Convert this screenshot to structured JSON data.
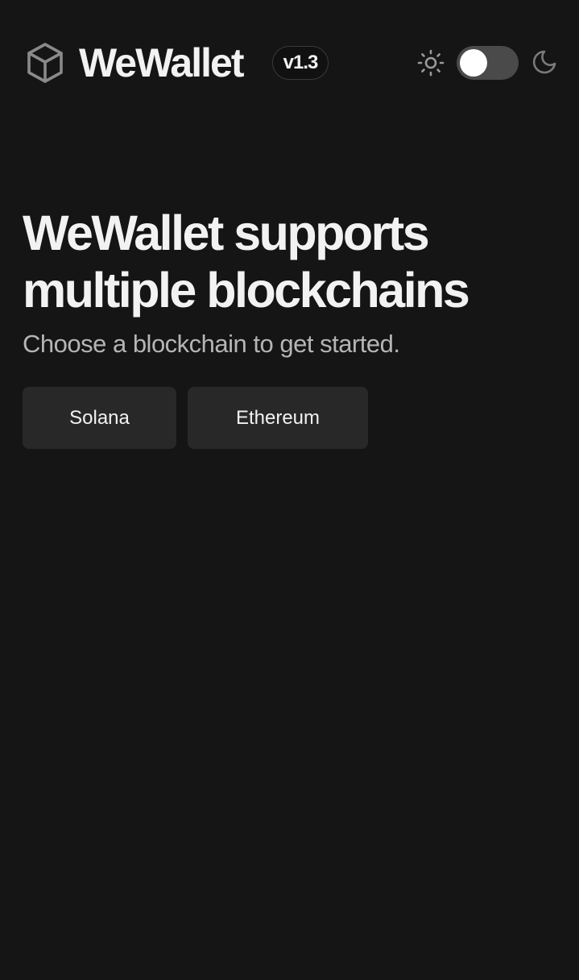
{
  "header": {
    "brand_name": "WeWallet",
    "version": "v1.3",
    "logo_icon": "cube-icon",
    "theme_toggle": {
      "light_icon": "sun-icon",
      "dark_icon": "moon-icon",
      "enabled": false
    }
  },
  "hero": {
    "title": "WeWallet supports multiple blockchains",
    "subtitle": "Choose a blockchain to get started."
  },
  "blockchains": [
    {
      "label": "Solana"
    },
    {
      "label": "Ethereum"
    }
  ],
  "colors": {
    "background": "#151515",
    "button_background": "#282828",
    "toggle_track": "#4a4a4a",
    "text_primary": "#f2f2f2",
    "text_secondary": "#b5b5b5"
  }
}
